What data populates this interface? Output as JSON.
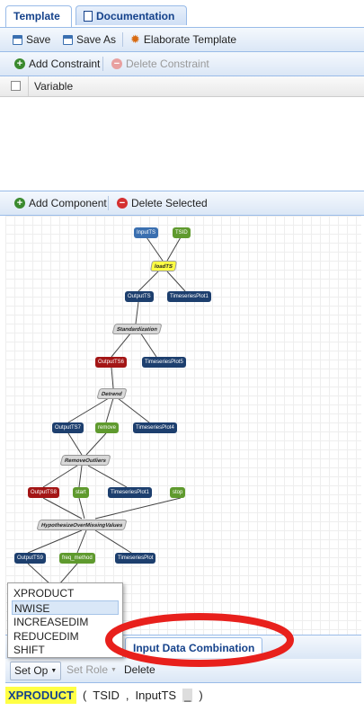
{
  "tabs": [
    {
      "label": "Template",
      "active": true
    },
    {
      "label": "Documentation",
      "active": false
    }
  ],
  "toolbar": {
    "save_label": "Save",
    "save_as_label": "Save As",
    "elaborate_label": "Elaborate Template"
  },
  "constraints": {
    "add_label": "Add Constraint",
    "delete_label": "Delete Constraint",
    "column_header": "Variable"
  },
  "components": {
    "add_label": "Add Component",
    "delete_label": "Delete Selected"
  },
  "graph": {
    "nodes": [
      {
        "label": "InputTS"
      },
      {
        "label": "TSID"
      },
      {
        "label": "loadTS"
      },
      {
        "label": "OutputTS"
      },
      {
        "label": "TimeseriesPlot1"
      },
      {
        "label": "Standardization"
      },
      {
        "label": "OutputTS6"
      },
      {
        "label": "TimeseriesPlot5"
      },
      {
        "label": "Detrend"
      },
      {
        "label": "OutputTS7"
      },
      {
        "label": "remove"
      },
      {
        "label": "TimeseriesPlot4"
      },
      {
        "label": "RemoveOutliers"
      },
      {
        "label": "OutputTS8"
      },
      {
        "label": "start"
      },
      {
        "label": "TimeseriesPlot1"
      },
      {
        "label": "stop"
      },
      {
        "label": "HypothesizeOverMissingValues"
      },
      {
        "label": "OutputTS9"
      },
      {
        "label": "freq_method"
      },
      {
        "label": "TimeseriesPlot"
      }
    ]
  },
  "dropdown": {
    "items": [
      "XPRODUCT",
      "NWISE",
      "INCREASEDIM",
      "REDUCEDIM",
      "SHIFT"
    ],
    "selected": "NWISE"
  },
  "bottom_panel": {
    "tab_label": "Input Data Combination",
    "set_op_label": "Set Op",
    "set_role_label": "Set Role",
    "delete_label": "Delete",
    "expr_op": "XPRODUCT",
    "expr_open": "(",
    "expr_arg1": "TSID",
    "expr_comma": ",",
    "expr_arg2": "InputTS",
    "expr_blank": "_",
    "expr_close": ")"
  },
  "colors": {
    "accent": "#15428b",
    "annotation_circle": "#e8201c",
    "highlight_yellow": "#ffff44"
  }
}
